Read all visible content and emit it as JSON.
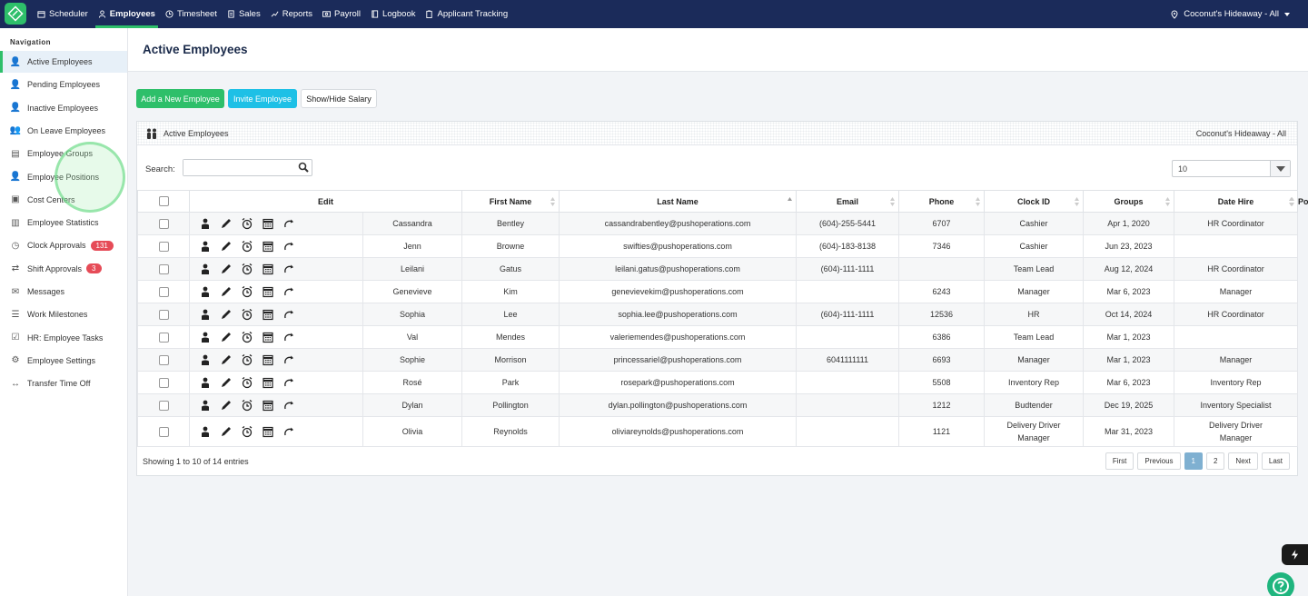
{
  "topbar": {
    "nav": [
      {
        "label": "Scheduler",
        "icon": "calendar-icon",
        "active": false
      },
      {
        "label": "Employees",
        "icon": "user-icon",
        "active": true
      },
      {
        "label": "Timesheet",
        "icon": "clock-icon",
        "active": false
      },
      {
        "label": "Sales",
        "icon": "receipt-icon",
        "active": false
      },
      {
        "label": "Reports",
        "icon": "chart-icon",
        "active": false
      },
      {
        "label": "Payroll",
        "icon": "money-icon",
        "active": false
      },
      {
        "label": "Logbook",
        "icon": "book-icon",
        "active": false
      },
      {
        "label": "Applicant Tracking",
        "icon": "clipboard-icon",
        "active": false
      }
    ],
    "location": "Coconut's Hideaway - All"
  },
  "sidebar": {
    "heading": "Navigation",
    "items": [
      {
        "label": "Active Employees",
        "icon": "user-icon",
        "active": true
      },
      {
        "label": "Pending Employees",
        "icon": "user-pending-icon"
      },
      {
        "label": "Inactive Employees",
        "icon": "user-inactive-icon"
      },
      {
        "label": "On Leave Employees",
        "icon": "users-icon"
      },
      {
        "label": "Employee Groups",
        "icon": "groups-icon"
      },
      {
        "label": "Employee Positions",
        "icon": "position-icon"
      },
      {
        "label": "Cost Centers",
        "icon": "cost-center-icon"
      },
      {
        "label": "Employee Statistics",
        "icon": "statistics-icon"
      },
      {
        "label": "Clock Approvals",
        "icon": "clock-icon",
        "badge": "131"
      },
      {
        "label": "Shift Approvals",
        "icon": "shift-icon",
        "badge": "3"
      },
      {
        "label": "Messages",
        "icon": "mail-icon"
      },
      {
        "label": "Work Milestones",
        "icon": "milestone-icon"
      },
      {
        "label": "HR: Employee Tasks",
        "icon": "tasks-icon"
      },
      {
        "label": "Employee Settings",
        "icon": "settings-icon"
      },
      {
        "label": "Transfer Time Off",
        "icon": "transfer-icon"
      }
    ]
  },
  "page": {
    "title": "Active Employees"
  },
  "buttons": {
    "add": "Add a New Employee",
    "invite": "Invite Employee",
    "salary": "Show/Hide Salary"
  },
  "card": {
    "title": "Active Employees",
    "location": "Coconut's Hideaway - All"
  },
  "search": {
    "label": "Search:",
    "value": "",
    "placeholder": ""
  },
  "page_length": "10",
  "table": {
    "headers": [
      "Edit",
      "First Name",
      "Last Name",
      "Email",
      "Phone",
      "Clock ID",
      "Groups",
      "Date Hire",
      "Position"
    ],
    "rows": [
      {
        "first": "Cassandra",
        "last": "Bentley",
        "email": "cassandrabentley@pushoperations.com",
        "phone": "(604)-255-5441",
        "clock": "6707",
        "groups": [
          "Cashier"
        ],
        "hire": "Apr 1, 2020",
        "position": [
          "HR Coordinator"
        ]
      },
      {
        "first": "Jenn",
        "last": "Browne",
        "email": "swifties@pushoperations.com",
        "phone": "(604)-183-8138",
        "clock": "7346",
        "groups": [
          "Cashier"
        ],
        "hire": "Jun 23, 2023",
        "position": []
      },
      {
        "first": "Leilani",
        "last": "Gatus",
        "email": "leilani.gatus@pushoperations.com",
        "phone": "(604)-111-1111",
        "clock": "",
        "groups": [
          "Team Lead"
        ],
        "hire": "Aug 12, 2024",
        "position": [
          "HR Coordinator"
        ]
      },
      {
        "first": "Genevieve",
        "last": "Kim",
        "email": "genevievekim@pushoperations.com",
        "phone": "",
        "clock": "6243",
        "groups": [
          "Manager"
        ],
        "hire": "Mar 6, 2023",
        "position": [
          "Manager"
        ]
      },
      {
        "first": "Sophia",
        "last": "Lee",
        "email": "sophia.lee@pushoperations.com",
        "phone": "(604)-111-1111",
        "clock": "12536",
        "groups": [
          "HR"
        ],
        "hire": "Oct 14, 2024",
        "position": [
          "HR Coordinator"
        ]
      },
      {
        "first": "Val",
        "last": "Mendes",
        "email": "valeriemendes@pushoperations.com",
        "phone": "",
        "clock": "6386",
        "groups": [
          "Team Lead"
        ],
        "hire": "Mar 1, 2023",
        "position": []
      },
      {
        "first": "Sophie",
        "last": "Morrison",
        "email": "princessariel@pushoperations.com",
        "phone": "6041111111",
        "clock": "6693",
        "groups": [
          "Manager"
        ],
        "hire": "Mar 1, 2023",
        "position": [
          "Manager"
        ]
      },
      {
        "first": "Rosé",
        "last": "Park",
        "email": "rosepark@pushoperations.com",
        "phone": "",
        "clock": "5508",
        "groups": [
          "Inventory Rep"
        ],
        "hire": "Mar 6, 2023",
        "position": [
          "Inventory Rep"
        ]
      },
      {
        "first": "Dylan",
        "last": "Pollington",
        "email": "dylan.pollington@pushoperations.com",
        "phone": "",
        "clock": "1212",
        "groups": [
          "Budtender"
        ],
        "hire": "Dec 19, 2025",
        "position": [
          "Inventory Specialist"
        ]
      },
      {
        "first": "Olivia",
        "last": "Reynolds",
        "email": "oliviareynolds@pushoperations.com",
        "phone": "",
        "clock": "1121",
        "groups": [
          "Delivery Driver",
          "Manager"
        ],
        "hire": "Mar 31, 2023",
        "position": [
          "Delivery Driver",
          "Manager"
        ]
      }
    ]
  },
  "footer": {
    "info": "Showing 1 to 10 of 14 entries",
    "pager": {
      "first": "First",
      "previous": "Previous",
      "pages": [
        "1",
        "2"
      ],
      "current": "1",
      "next": "Next",
      "last": "Last"
    }
  },
  "colors": {
    "topbar": "#1b2b5a",
    "accent_green": "#2ebf6a",
    "accent_cyan": "#1ec0e6",
    "badge_red": "#e64b57"
  }
}
